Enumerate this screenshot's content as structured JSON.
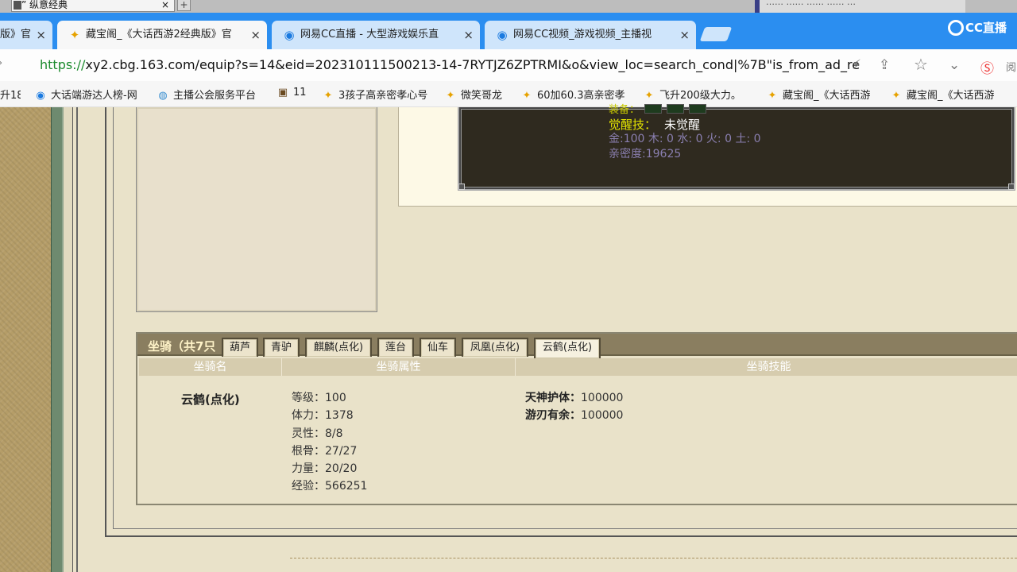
{
  "top": {
    "old_tab_title": "” 纵意经典",
    "old_tab_close": "×",
    "old_tab_plus": "+",
    "ghost_text": "…… ……   ……  ……   …"
  },
  "tabs": [
    {
      "title": "版》官",
      "close": "×"
    },
    {
      "title": "藏宝阁_《大话西游2经典版》官",
      "close": "×"
    },
    {
      "title": "网易CC直播 - 大型游戏娱乐直",
      "close": "×"
    },
    {
      "title": "网易CC视频_游戏视频_主播视",
      "close": "×"
    }
  ],
  "cc_logo_text": "CC直播",
  "address": {
    "left_char": "›",
    "url_prefix": "https://",
    "url_rest": "xy2.cbg.163.com/equip?s=14&eid=202310111500213-14-7RYTJZ6ZPTRMI&o&view_loc=search_cond|%7B\"is_from_ad_re",
    "icons": [
      "⚡",
      "⇪",
      "☆",
      "⌄",
      "Ⓢ",
      "阅"
    ]
  },
  "bookmarks": [
    {
      "icon": "",
      "label": "升18"
    },
    {
      "icon": "◉",
      "label": "大话端游达人榜-网"
    },
    {
      "icon": "◍",
      "label": "主播公会服务平台"
    },
    {
      "icon": "▣",
      "label": "11"
    },
    {
      "icon": "✦",
      "label": "3孩子高亲密孝心号"
    },
    {
      "icon": "✦",
      "label": "微笑哥龙"
    },
    {
      "icon": "✦",
      "label": "60加60.3高亲密孝"
    },
    {
      "icon": "✦",
      "label": "飞升200级大力。"
    },
    {
      "icon": "✦",
      "label": "藏宝阁_《大话西游"
    },
    {
      "icon": "✦",
      "label": "藏宝阁_《大话西游"
    }
  ],
  "pet_info": {
    "partial_label": "装备：",
    "awaken_label": "觉醒技：",
    "awaken_value": "未觉醒",
    "elements": "金:100 木: 0 水: 0 火: 0 土: 0",
    "intimacy": "亲密度:19625"
  },
  "mounts": {
    "title": "坐骑（共7只",
    "tabs": [
      "葫芦",
      "青驴",
      "麒麟(点化)",
      "莲台",
      "仙车",
      "凤凰(点化)",
      "云鹤(点化)"
    ],
    "active_tab": "云鹤(点化)",
    "columns": [
      "坐骑名",
      "坐骑属性",
      "坐骑技能"
    ],
    "mount_name": "云鹤(点化)",
    "attributes": [
      "等级：100",
      "体力：1378",
      "灵性：8/8",
      "根骨：27/27",
      "力量：20/20",
      "经验：566251"
    ],
    "skills": [
      {
        "name": "天神护体：",
        "value": "100000"
      },
      {
        "name": "游刃有余：",
        "value": "100000"
      }
    ]
  }
}
